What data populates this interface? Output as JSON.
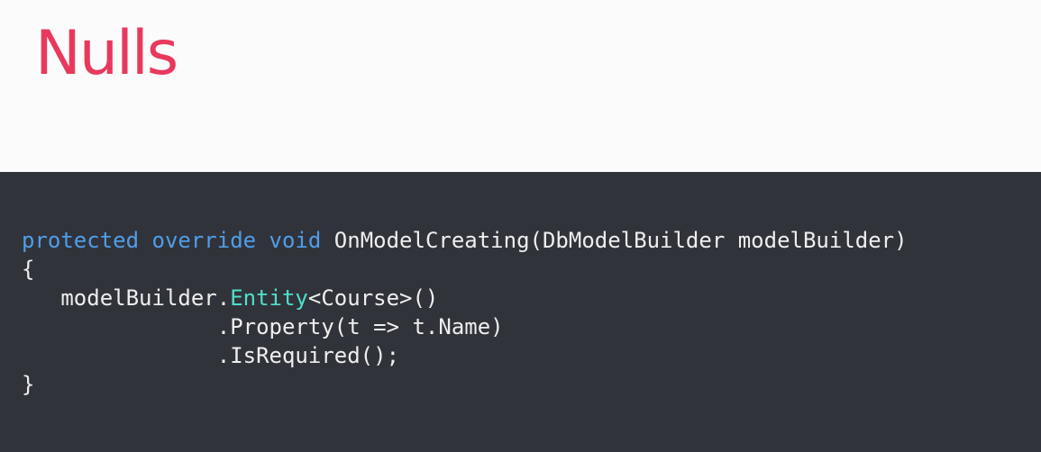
{
  "slide": {
    "title": "Nulls"
  },
  "colors": {
    "title": "#e8395c",
    "panel_background": "#31333b",
    "page_background": "#fbfbfc",
    "keyword": "#4f9ee8",
    "type_name": "#4ee0c9",
    "plain_text": "#eeeeee"
  },
  "code": {
    "language": "csharp",
    "lines": [
      [
        {
          "text": "protected",
          "kind": "keyword"
        },
        {
          "text": " ",
          "kind": "plain"
        },
        {
          "text": "override",
          "kind": "keyword"
        },
        {
          "text": " ",
          "kind": "plain"
        },
        {
          "text": "void",
          "kind": "keyword"
        },
        {
          "text": " OnModelCreating(DbModelBuilder modelBuilder)",
          "kind": "plain"
        }
      ],
      [
        {
          "text": "{",
          "kind": "plain"
        }
      ],
      [
        {
          "text": "   modelBuilder.",
          "kind": "plain"
        },
        {
          "text": "Entity",
          "kind": "type"
        },
        {
          "text": "<Course>()",
          "kind": "plain"
        }
      ],
      [
        {
          "text": "               .Property(t => t.Name)",
          "kind": "plain"
        }
      ],
      [
        {
          "text": "               .IsRequired();",
          "kind": "plain"
        }
      ],
      [
        {
          "text": "}",
          "kind": "plain"
        }
      ]
    ]
  }
}
